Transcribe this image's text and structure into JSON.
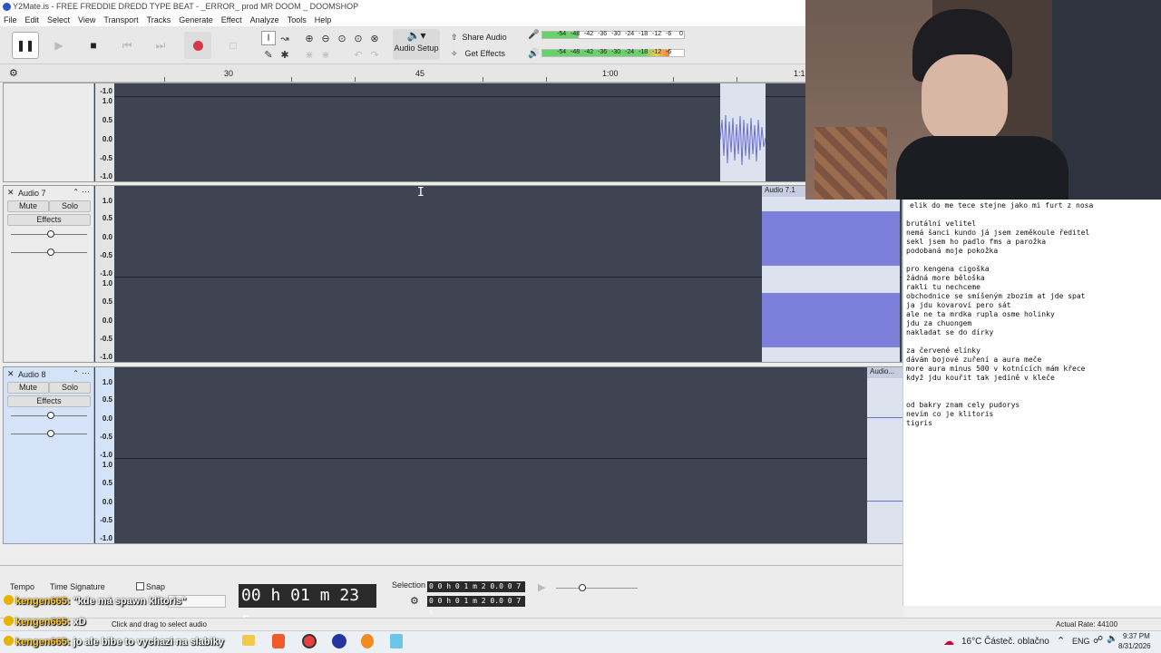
{
  "window": {
    "title": "Y2Mate.is - FREE FREDDIE DREDD TYPE BEAT - _ERROR_ prod MR DOOM _ DOOMSHOP"
  },
  "menu": [
    "File",
    "Edit",
    "Select",
    "View",
    "Transport",
    "Tracks",
    "Generate",
    "Effect",
    "Analyze",
    "Tools",
    "Help"
  ],
  "toolbar": {
    "audio_setup": "Audio Setup",
    "share_audio": "Share Audio",
    "get_effects": "Get Effects",
    "meter_ticks": [
      "-54",
      "-48",
      "-42",
      "-36",
      "-30",
      "-24",
      "-18",
      "-12",
      "-6",
      "0"
    ]
  },
  "timeline": {
    "ticks": [
      "30",
      "45",
      "1:00",
      "1:15"
    ]
  },
  "scale_labels": [
    "1.0",
    "0.5",
    "0.0",
    "-0.5",
    "-1.0"
  ],
  "tracks": [
    {
      "name": "",
      "clip_title": ""
    },
    {
      "name": "Audio 7",
      "mute": "Mute",
      "solo": "Solo",
      "effects": "Effects",
      "clip_title": "Audio 7.1"
    },
    {
      "name": "Audio 8",
      "mute": "Mute",
      "solo": "Solo",
      "effects": "Effects",
      "clip_title": "Audio..."
    }
  ],
  "bottom": {
    "tempo": "Tempo",
    "time_signature": "Time Signature",
    "snap": "Snap",
    "time": "00 h 01 m 23 s",
    "selection": "Selection",
    "sel_start": "0 0 h 0 1 m 2 0.0 0 7 s",
    "sel_end": "0 0 h 0 1 m 2 0.0 0 7 s"
  },
  "status": {
    "hint": "Click and drag to select audio",
    "rate": "Actual Rate: 44100"
  },
  "chat": [
    {
      "user": "kengen665:",
      "text": " \"kde má spawn klitoris\""
    },
    {
      "user": "kengen665:",
      "text": " xD"
    },
    {
      "user": "kengen665:",
      "text": " jo ale bibe to vychazi na slabiky"
    }
  ],
  "lyrics": [
    "elik do me tece stejne jako mi furt z nosa",
    "",
    "brutální velitel",
    "nemá šanci kundo já jsem zeměkoule ředitel",
    "sekl jsem ho padlo fms a parožka",
    "podobaná moje pokožka",
    "",
    "pro kengena cigoška",
    "žádná more běloška",
    "rakli tu nechceme",
    "obchodnice se smíšeným zbozim at jde spat",
    "ja jdu kovaroví pero sát",
    "ale ne ta mrdka rupla osme holinky",
    "jdu za chuongem",
    "nakladat se do dírky",
    "",
    "za červené elínky",
    "dávám bojové zuření a aura meče",
    "more aura minus 500 v kotnících mám křece",
    "když jdu kouřit tak jedině v kleče",
    "",
    "",
    "od bakry znam cely pudorys",
    "nevím co je klitoris",
    "tigris"
  ],
  "taskbar": {
    "weather": "16°C  Částeč. oblačno",
    "lang": "ENG",
    "time": "9:37 PM",
    "date": "8/31/2026"
  },
  "colors": {
    "waveform": "#6b6fd6",
    "track_bg": "#3e4451",
    "record": "#d9374a"
  }
}
